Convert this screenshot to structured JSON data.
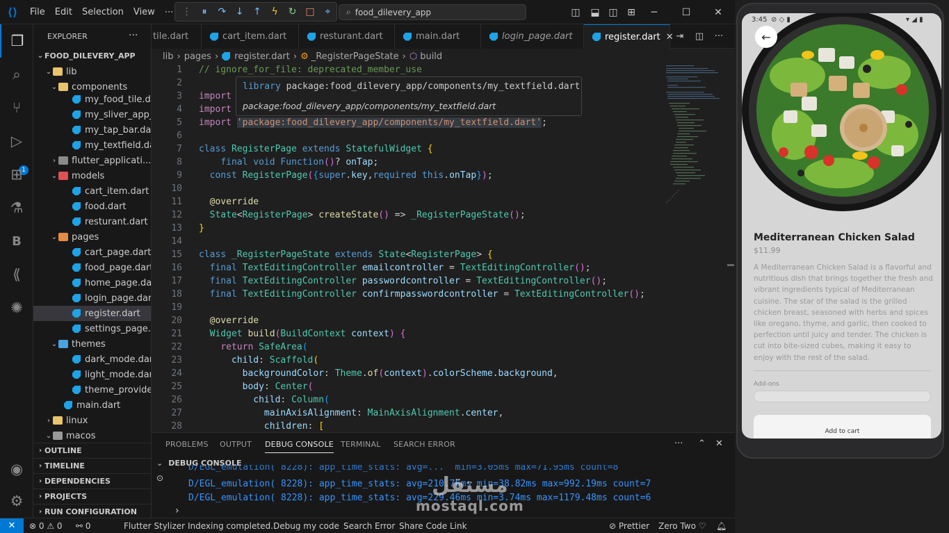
{
  "titlebar": {
    "menus": [
      "File",
      "Edit",
      "Selection",
      "View",
      "⋯"
    ],
    "search_text": "food_dilevery_app"
  },
  "explorer": {
    "title": "EXPLORER",
    "more": "···",
    "root": "FOOD_DILEVERY_APP",
    "items": [
      {
        "label": "lib",
        "kind": "folder-open"
      },
      {
        "label": "components",
        "kind": "folder-open"
      },
      {
        "label": "my_food_tile.d...",
        "kind": "dart"
      },
      {
        "label": "my_sliver_app_...",
        "kind": "dart"
      },
      {
        "label": "my_tap_bar.dart",
        "kind": "dart"
      },
      {
        "label": "my_textfield.dart",
        "kind": "dart"
      },
      {
        "label": "flutter_applicati...",
        "kind": "folder"
      },
      {
        "label": "models",
        "kind": "folder-open"
      },
      {
        "label": "cart_item.dart",
        "kind": "dart"
      },
      {
        "label": "food.dart",
        "kind": "dart"
      },
      {
        "label": "resturant.dart",
        "kind": "dart"
      },
      {
        "label": "pages",
        "kind": "folder-open"
      },
      {
        "label": "cart_page.dart",
        "kind": "dart"
      },
      {
        "label": "food_page.dart",
        "kind": "dart"
      },
      {
        "label": "home_page.dart",
        "kind": "dart"
      },
      {
        "label": "login_page.dart",
        "kind": "dart"
      },
      {
        "label": "register.dart",
        "kind": "dart"
      },
      {
        "label": "settings_page....",
        "kind": "dart"
      },
      {
        "label": "themes",
        "kind": "folder-open"
      },
      {
        "label": "dark_mode.dart",
        "kind": "dart"
      },
      {
        "label": "light_mode.dart",
        "kind": "dart"
      },
      {
        "label": "theme_provide...",
        "kind": "dart"
      },
      {
        "label": "main.dart",
        "kind": "dart"
      },
      {
        "label": "linux",
        "kind": "folder"
      },
      {
        "label": "macos",
        "kind": "folder"
      }
    ],
    "sections": [
      "OUTLINE",
      "TIMELINE",
      "DEPENDENCIES",
      "PROJECTS",
      "RUN CONFIGURATION"
    ]
  },
  "tabs": [
    {
      "label": "tile.dart"
    },
    {
      "label": "cart_item.dart"
    },
    {
      "label": "resturant.dart"
    },
    {
      "label": "main.dart"
    },
    {
      "label": "login_page.dart"
    },
    {
      "label": "register.dart",
      "active": true
    }
  ],
  "breadcrumb": [
    "lib",
    "pages",
    "register.dart",
    "_RegisterPageState",
    "build"
  ],
  "hover": {
    "line1_kw": "library",
    "line1_rest": "package:food_dilevery_app/components/my_textfield.dart",
    "line2": "package:food_dilevery_app/components/my_textfield.dart"
  },
  "editor": {
    "line_numbers": [
      "1",
      "2",
      "3",
      "4",
      "5",
      "6",
      "7",
      "8",
      "9",
      "10",
      "11",
      "12",
      "13",
      "14",
      "15",
      "16",
      "17",
      "18",
      "19",
      "20",
      "21",
      "22",
      "23",
      "24",
      "25",
      "26",
      "27",
      "28"
    ]
  },
  "panel": {
    "tabs": [
      "PROBLEMS",
      "OUTPUT",
      "DEBUG CONSOLE",
      "TERMINAL",
      "SEARCH ERROR"
    ],
    "section_title": "DEBUG CONSOLE",
    "logs": [
      "D/EGL_emulation( 8228): app_time_stats: avg=210.76ms min=38.82ms max=992.19ms count=7",
      "D/EGL_emulation( 8228): app_time_stats: avg=229.46ms min=3.74ms max=1179.48ms count=6"
    ],
    "partial_log": "D/EGL_emulation( 8228): app_time_stats: avg=...  min=3.05ms max=71.95ms count=8"
  },
  "statusbar": {
    "remote": "✕",
    "problems": "⊗ 0 ⚠ 0",
    "ports": "⚯ 0",
    "items": [
      "Flutter Stylizer",
      "Indexing completed.",
      "Debug my code",
      "Search Error",
      "Share Code Link"
    ],
    "prettier": "Prettier",
    "theme": "Zero Two"
  },
  "phone": {
    "time": "3:45",
    "dish_title": "Mediterranean Chicken Salad",
    "price": "$11.99",
    "description": "A Mediterranean Chicken Salad is a flavorful and nutritious dish that brings together the fresh and vibrant ingredients typical of Mediterranean cuisine. The star of the salad is the grilled chicken breast, seasoned with herbs and spices like oregano, thyme, and garlic, then cooked to perfection until juicy and tender. The chicken is cut into bite-sized cubes, making it easy to enjoy with the rest of the salad.",
    "addons_label": "Add-ons",
    "add_to_cart": "Add to cart"
  },
  "watermark": {
    "arabic": "مستقل",
    "latin": "mostaql.com"
  }
}
